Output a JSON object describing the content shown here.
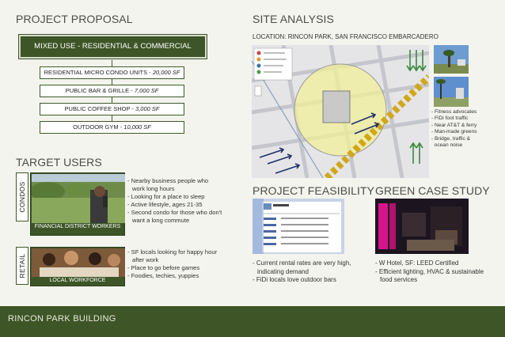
{
  "left": {
    "title": "PROJECT PROPOSAL",
    "mixed_use": "MIXED USE - RESIDENTIAL & COMMERCIAL",
    "components": [
      {
        "label": "RESIDENTIAL MICRO CONDO UNITS - ",
        "value": "20,000 SF"
      },
      {
        "label": "PUBLIC BAR & GRILLE - ",
        "value": "7,000 SF"
      },
      {
        "label": "PUBLIC COFFEE SHOP - ",
        "value": "3,000 SF"
      },
      {
        "label": "OUTDOOR GYM - ",
        "value": "10,000 SF"
      }
    ],
    "target_users_title": "TARGET USERS",
    "condos": {
      "side_label": "CONDOS",
      "caption": "FINANCIAL DISTRICT WORKERS",
      "bullets": [
        "- Nearby business people who work long hours",
        "- Looking for a place to sleep",
        "- Active lifestyle, ages 21-35",
        "- Second condo for those who don't want a long commute"
      ]
    },
    "retail": {
      "side_label": "RETAIL",
      "caption": "LOCAL WORKFORCE",
      "bullets": [
        "- SF locals looking for happy hour after work",
        "- Place to go before games",
        "- Foodies, techies, yuppies"
      ]
    }
  },
  "right": {
    "site_title": "SITE ANALYSIS",
    "location": "LOCATION: RINCON PARK, SAN FRANCISCO EMBARCADERO",
    "site_notes": [
      "- Fitness advocates",
      "- FiDi foot traffic",
      "- Near AT&T & ferry",
      "- Man-made greens",
      "- Bridge, traffic &",
      "  ocean noise"
    ],
    "feasibility_title": "PROJECT FEASIBILITY",
    "feasibility_bullets": [
      "- Current rental rates are very high, indicating demand",
      "- FiDi locals love outdoor bars"
    ],
    "green_title": "GREEN CASE STUDY",
    "green_bullets": [
      "- W Hotel, SF: LEED Certified",
      "- Efficient lighting, HVAC & sustainable food services"
    ]
  },
  "footer": {
    "title": "RINCON PARK BUILDING"
  },
  "colors": {
    "accent": "#3d5527",
    "background": "#f3f4ee"
  }
}
